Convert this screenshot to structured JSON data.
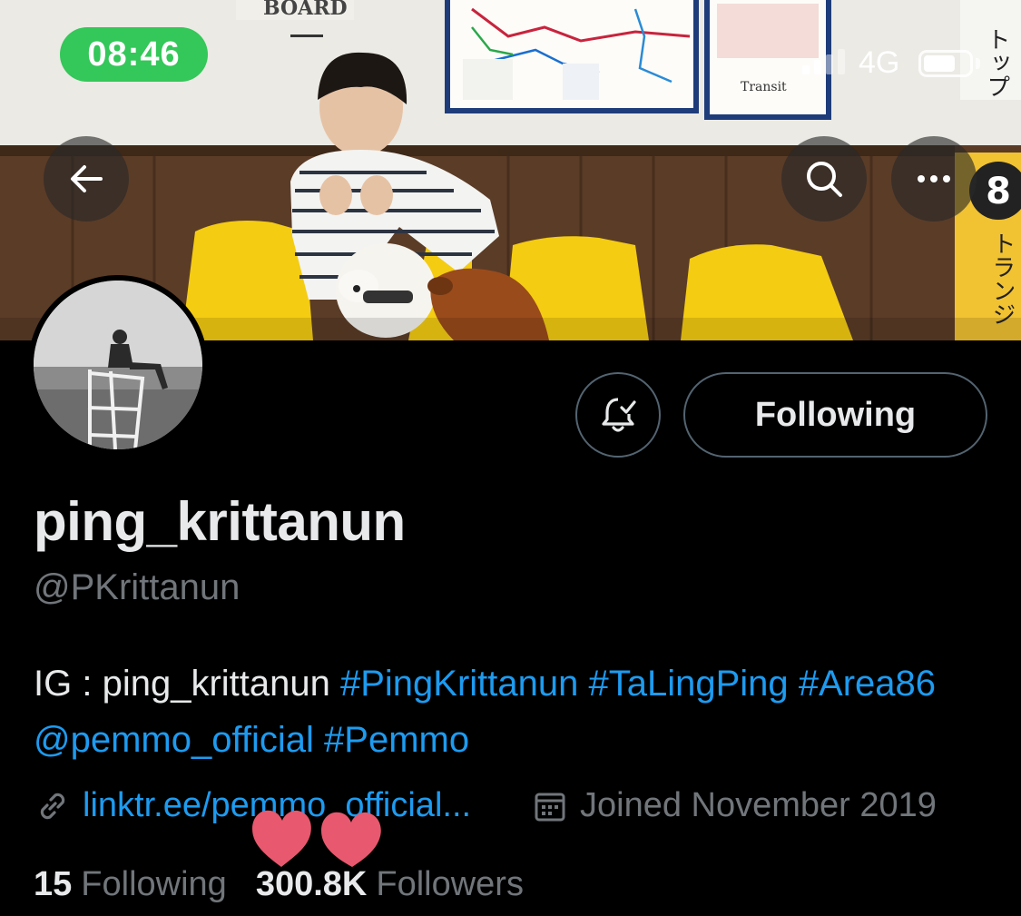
{
  "status_bar": {
    "time": "08:46",
    "network": "4G"
  },
  "banner": {
    "sign_text": "BOARD",
    "map_brand": "Transit",
    "side_sign_top": "トップ",
    "side_sign_number": "8",
    "side_sign_bottom": "トランジ"
  },
  "nav": {
    "back_icon": "arrow-left-icon",
    "search_icon": "search-icon",
    "more_icon": "more-horizontal-icon"
  },
  "actions": {
    "notifications_icon": "bell-check-icon",
    "following_label": "Following"
  },
  "profile": {
    "display_name": "ping_krittanun",
    "handle": "@PKrittanun",
    "bio": {
      "prefix": "IG : ping_krittanun ",
      "tag1": "#PingKrittanun",
      "tag2": "#TaLingPing",
      "tag3": "#Area86",
      "mention": "@pemmo_official",
      "tag4": "#Pemmo"
    },
    "link": "linktr.ee/pemmo_official...",
    "joined": "Joined November 2019"
  },
  "stats": {
    "following_count": "15",
    "following_label": "Following",
    "followers_count": "300.8K",
    "followers_label": "Followers"
  },
  "colors": {
    "background": "#000000",
    "text_primary": "#e7e9ea",
    "text_secondary": "#71767b",
    "link_blue": "#1d9bf0",
    "status_green": "#34c759",
    "button_border": "#536471",
    "heart_pink": "#e8586e"
  },
  "overlay_icon": "hearts-sticker-icon"
}
